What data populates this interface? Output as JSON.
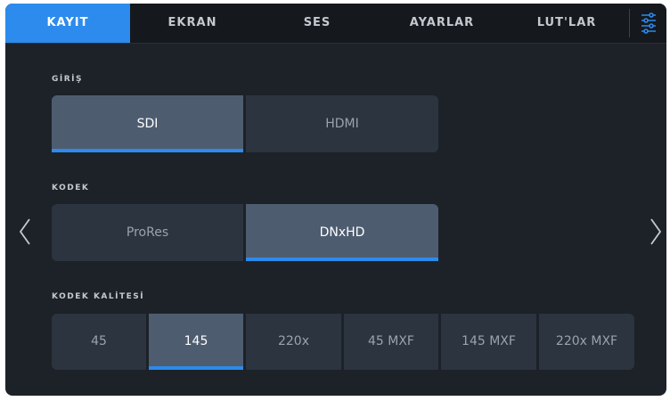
{
  "tabs": [
    {
      "label": "KAYIT",
      "active": true
    },
    {
      "label": "EKRAN",
      "active": false
    },
    {
      "label": "SES",
      "active": false
    },
    {
      "label": "AYARLAR",
      "active": false
    },
    {
      "label": "LUT'LAR",
      "active": false
    }
  ],
  "menu_icon": "sliders-icon",
  "sections": {
    "input": {
      "label": "GİRİŞ",
      "options": [
        "SDI",
        "HDMI"
      ],
      "selected": "SDI"
    },
    "codec": {
      "label": "KODEK",
      "options": [
        "ProRes",
        "DNxHD"
      ],
      "selected": "DNxHD"
    },
    "quality": {
      "label": "KODEK KALİTESİ",
      "options": [
        "45",
        "145",
        "220x",
        "45 MXF",
        "145 MXF",
        "220x MXF"
      ],
      "selected": "145"
    }
  },
  "nav": {
    "prev_icon": "chevron-left-icon",
    "next_icon": "chevron-right-icon"
  },
  "colors": {
    "accent": "#2c8bec",
    "selected_bg": "#4e5c70",
    "option_bg": "#2c343f",
    "screen_bg": "#1d2228"
  }
}
